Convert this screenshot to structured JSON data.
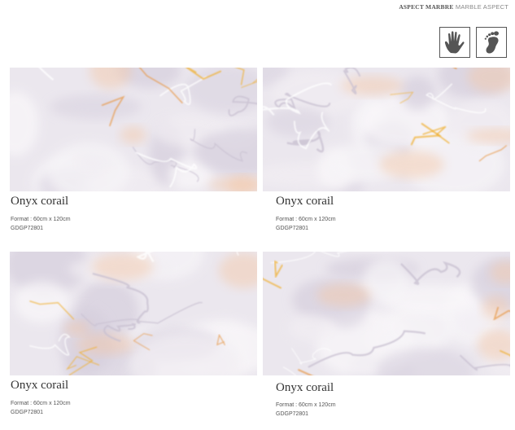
{
  "header": {
    "fr": "ASPECT MARBRE",
    "en": "MARBLE ASPECT"
  },
  "icons": [
    "hand-icon",
    "foot-icon"
  ],
  "colors": {
    "marble_base": "#ebe7ee",
    "vein": "#e89a4a",
    "vein_gold": "#f0b030"
  },
  "products": [
    {
      "name": "Onyx corail",
      "format": "Format : 60cm x 120cm",
      "code": "GDGP72801"
    },
    {
      "name": "Onyx corail",
      "format": "Format : 60cm x 120cm",
      "code": "GDGP72801"
    },
    {
      "name": "Onyx corail",
      "format": "Format : 60cm x 120cm",
      "code": "GDGP72801"
    },
    {
      "name": "Onyx corail",
      "format": "Format : 60cm x 120cm",
      "code": "GDGP72801"
    }
  ]
}
